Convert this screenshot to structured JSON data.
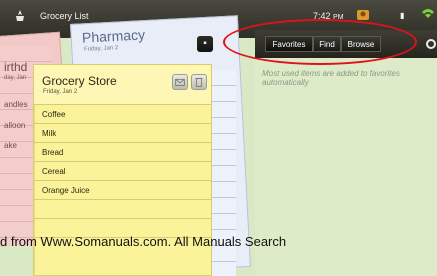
{
  "statusbar": {
    "app_title": "Grocery List",
    "time": "7:42",
    "ampm": "PM"
  },
  "tabs": {
    "favorites": "Favorites",
    "find": "Find",
    "browse": "Browse"
  },
  "hint": "Most used items are added to favorites automatically",
  "pink_list": {
    "title_partial": "irthd",
    "date_partial": "day, Jan",
    "items": [
      "andles",
      "alloon",
      "ake"
    ]
  },
  "blue_list": {
    "title": "Pharmacy",
    "date": "Friday, Jan 2"
  },
  "grocery_list": {
    "title": "Grocery Store",
    "date": "Friday, Jan 2",
    "items": [
      "Coffee",
      "Milk",
      "Bread",
      "Cereal",
      "Orange Juice"
    ]
  },
  "watermark": "d from Www.Somanuals.com. All Manuals Search"
}
